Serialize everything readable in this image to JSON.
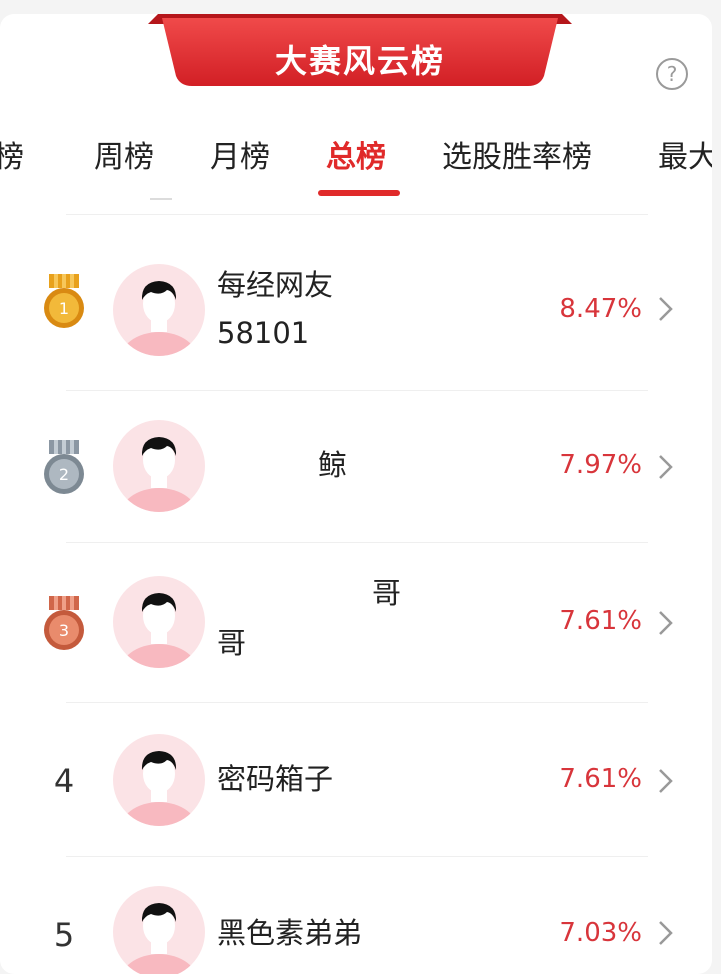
{
  "header": {
    "title": "大赛风云榜",
    "help_icon": "question-circle-icon",
    "help_glyph": "?"
  },
  "tabs": [
    {
      "label": "日榜",
      "partial_text": "榜"
    },
    {
      "label": "周榜"
    },
    {
      "label": "月榜"
    },
    {
      "label": "总榜",
      "active": true
    },
    {
      "label": "选股胜率榜"
    },
    {
      "label": "最大"
    }
  ],
  "colors": {
    "accent": "#e02a2a",
    "rate_text": "#d8353b",
    "avatar_bg": "#fbe3e6",
    "gold": "#e8a11c",
    "silver": "#8b97a3",
    "bronze": "#d0664a"
  },
  "leaderboard": [
    {
      "rank": "1",
      "medal": "gold-medal-icon",
      "name_line1": "每经网友",
      "name_line2": "58101",
      "rate": "8.47%"
    },
    {
      "rank": "2",
      "medal": "silver-medal-icon",
      "name_line1": "鲸",
      "name_line2": "",
      "rate": "7.97%"
    },
    {
      "rank": "3",
      "medal": "bronze-medal-icon",
      "name_line1": "哥",
      "name_line2": "哥",
      "rate": "7.61%"
    },
    {
      "rank": "4",
      "name_line1": "密码箱子",
      "name_line2": "",
      "rate": "7.61%"
    },
    {
      "rank": "5",
      "name_line1": "黑色素弟弟",
      "name_line2": "",
      "rate": "7.03%"
    }
  ]
}
